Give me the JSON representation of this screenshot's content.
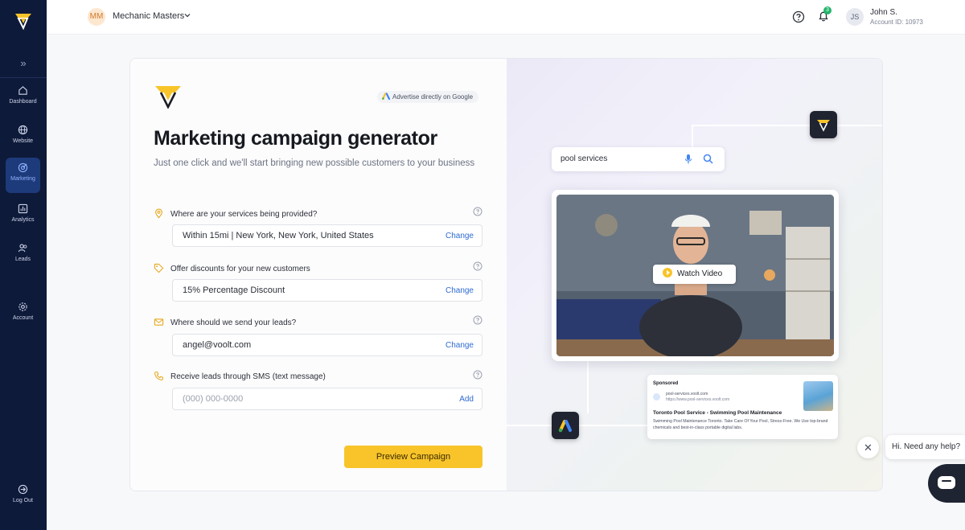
{
  "sidebar": {
    "items": [
      {
        "label": "Dashboard",
        "icon": "home-icon"
      },
      {
        "label": "Website",
        "icon": "globe-icon"
      },
      {
        "label": "Marketing",
        "icon": "marketing-icon",
        "active": true
      },
      {
        "label": "Analytics",
        "icon": "analytics-icon"
      },
      {
        "label": "Leads",
        "icon": "leads-icon"
      },
      {
        "label": "Account",
        "icon": "gear-icon"
      }
    ],
    "logout_label": "Log Out"
  },
  "topbar": {
    "org_initials": "MM",
    "org_name": "Mechanic Masters",
    "notification_count": "3",
    "user_initials": "JS",
    "user_name": "John S.",
    "account_id": "Account ID: 10973"
  },
  "form": {
    "google_badge": "Advertise directly on Google",
    "title": "Marketing campaign generator",
    "subtitle": "Just one click and we'll start bringing new possible customers to your business",
    "fields": [
      {
        "label": "Where are your services being provided?",
        "value": "Within 15mi | New York, New York, United States",
        "action": "Change",
        "icon": "location-pin-icon"
      },
      {
        "label": "Offer discounts for your new customers",
        "value": "15% Percentage Discount",
        "action": "Change",
        "icon": "tag-icon"
      },
      {
        "label": "Where should we send your leads?",
        "value": "angel@voolt.com",
        "action": "Change",
        "icon": "mail-icon"
      },
      {
        "label": "Receive leads through SMS (text message)",
        "placeholder": "(000) 000-0000",
        "action": "Add",
        "icon": "phone-icon"
      }
    ],
    "preview_button": "Preview Campaign"
  },
  "illustration": {
    "search_query": "pool services",
    "watch_video": "Watch Video",
    "ad": {
      "sponsored": "Sponsored",
      "domain": "pool-services.voolt.com",
      "url": "https://www.pool-services.voolt.com",
      "title": "Toronto Pool Service - Swimming Pool Maintenance",
      "description": "Swimming Pool Maintenance Toronto. Take Care Of Your Pool, Stress-Free. We Use top-brand chemicals and best-in-class portable digital labs."
    }
  },
  "help_widget": {
    "prompt": "Hi. Need any help?"
  },
  "colors": {
    "sidebar_bg": "#0e1a3a",
    "accent_yellow": "#f8c42a",
    "link_blue": "#2f6bd1"
  }
}
